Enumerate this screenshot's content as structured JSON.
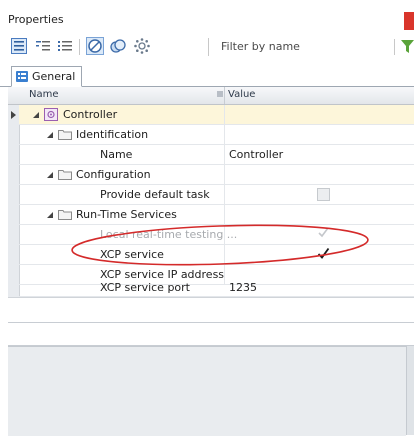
{
  "window": {
    "title": "Properties"
  },
  "toolbar": {
    "filter_placeholder": "Filter by name",
    "icons": [
      "categorized-view-icon",
      "alphabetical-view-icon",
      "list-view-icon",
      "show-all-icon",
      "show-modified-icon",
      "settings-icon",
      "filter-icon"
    ]
  },
  "tabs": [
    {
      "label": "General",
      "active": true
    }
  ],
  "grid": {
    "columns": [
      "Name",
      "Value"
    ],
    "rows": [
      {
        "label": "Controller",
        "value": "",
        "level": 0,
        "type": "node",
        "selected": true
      },
      {
        "label": "Identification",
        "value": "",
        "level": 1,
        "type": "folder"
      },
      {
        "label": "Name",
        "value": "Controller",
        "level": 2,
        "type": "property"
      },
      {
        "label": "Configuration",
        "value": "",
        "level": 1,
        "type": "folder"
      },
      {
        "label": "Provide default task",
        "value": "",
        "level": 2,
        "type": "checkbox",
        "checked": false,
        "disabled": true
      },
      {
        "label": "Run-Time Services",
        "value": "",
        "level": 1,
        "type": "folder"
      },
      {
        "label": "Local real-time testing ...",
        "value": "",
        "level": 2,
        "type": "checkbox",
        "checked": true,
        "disabled": true
      },
      {
        "label": "XCP service",
        "value": "",
        "level": 2,
        "type": "checkbox",
        "checked": true,
        "disabled": false
      },
      {
        "label": "XCP service IP address",
        "value": "",
        "level": 2,
        "type": "property"
      },
      {
        "label": "XCP service port",
        "value": "1235",
        "level": 2,
        "type": "property"
      }
    ]
  },
  "annotation": {
    "color": "#d42a2a",
    "target": "XCP service"
  },
  "colors": {
    "selection_row": "#fdf6da",
    "close_button": "#d9352b",
    "accent": "#3a7fd0"
  }
}
